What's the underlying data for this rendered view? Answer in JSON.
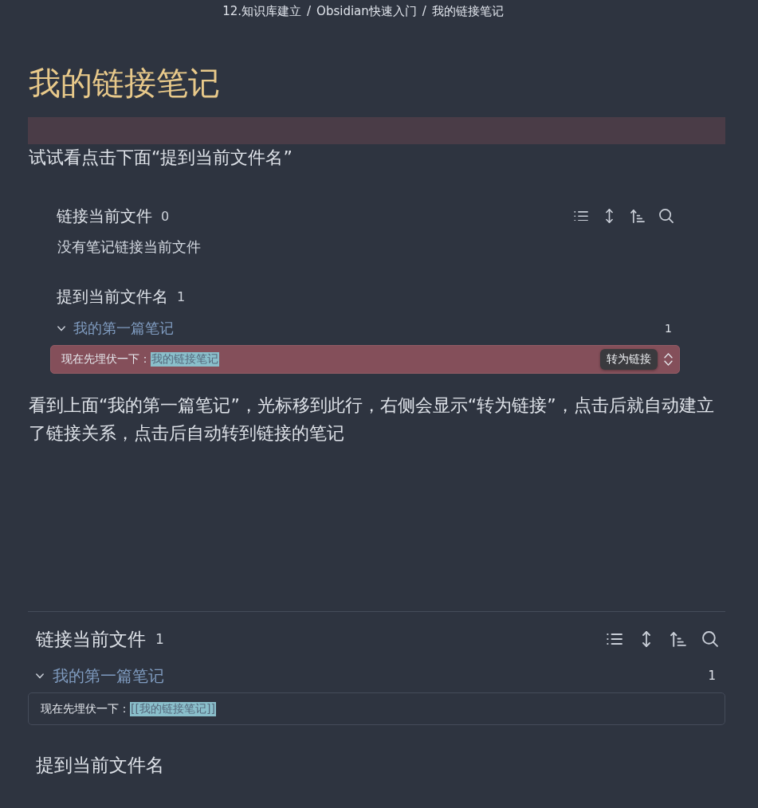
{
  "breadcrumb": [
    {
      "text": "12.知识库建立",
      "separator": "/"
    },
    {
      "text": "Obsidian快速入门",
      "separator": "/"
    },
    {
      "text": "我的链接笔记"
    }
  ],
  "title": "我的链接笔记",
  "intro": "试试看点击下面“提到当前文件名”",
  "embedded_backlinks": {
    "sections": [
      {
        "heading": "链接当前文件",
        "count": "0",
        "empty_message": "没有笔记链接当前文件"
      },
      {
        "heading": "提到当前文件名",
        "count": "1",
        "groups": [
          {
            "file": "我的第一篇笔记",
            "expanded": true,
            "count": "1",
            "matches": [
              {
                "before": "现在先埋伏一下：",
                "match": "我的链接笔记",
                "hovered": true,
                "action": "转为链接"
              }
            ]
          }
        ]
      }
    ]
  },
  "explanation": "看到上面“我的第一篇笔记”，光标移到此行，右侧会显示“转为链接”，点击后就自动建立了链接关系，点击后自动转到链接的笔记",
  "backlinks_pane": {
    "sections": [
      {
        "heading": "链接当前文件",
        "count": "1",
        "groups": [
          {
            "file": "我的第一篇笔记",
            "expanded": true,
            "count": "1",
            "matches": [
              {
                "before": "现在先埋伏一下：",
                "match": "[[我的链接笔记]]",
                "hovered": false
              }
            ]
          }
        ]
      },
      {
        "heading": "提到当前文件名"
      }
    ]
  }
}
